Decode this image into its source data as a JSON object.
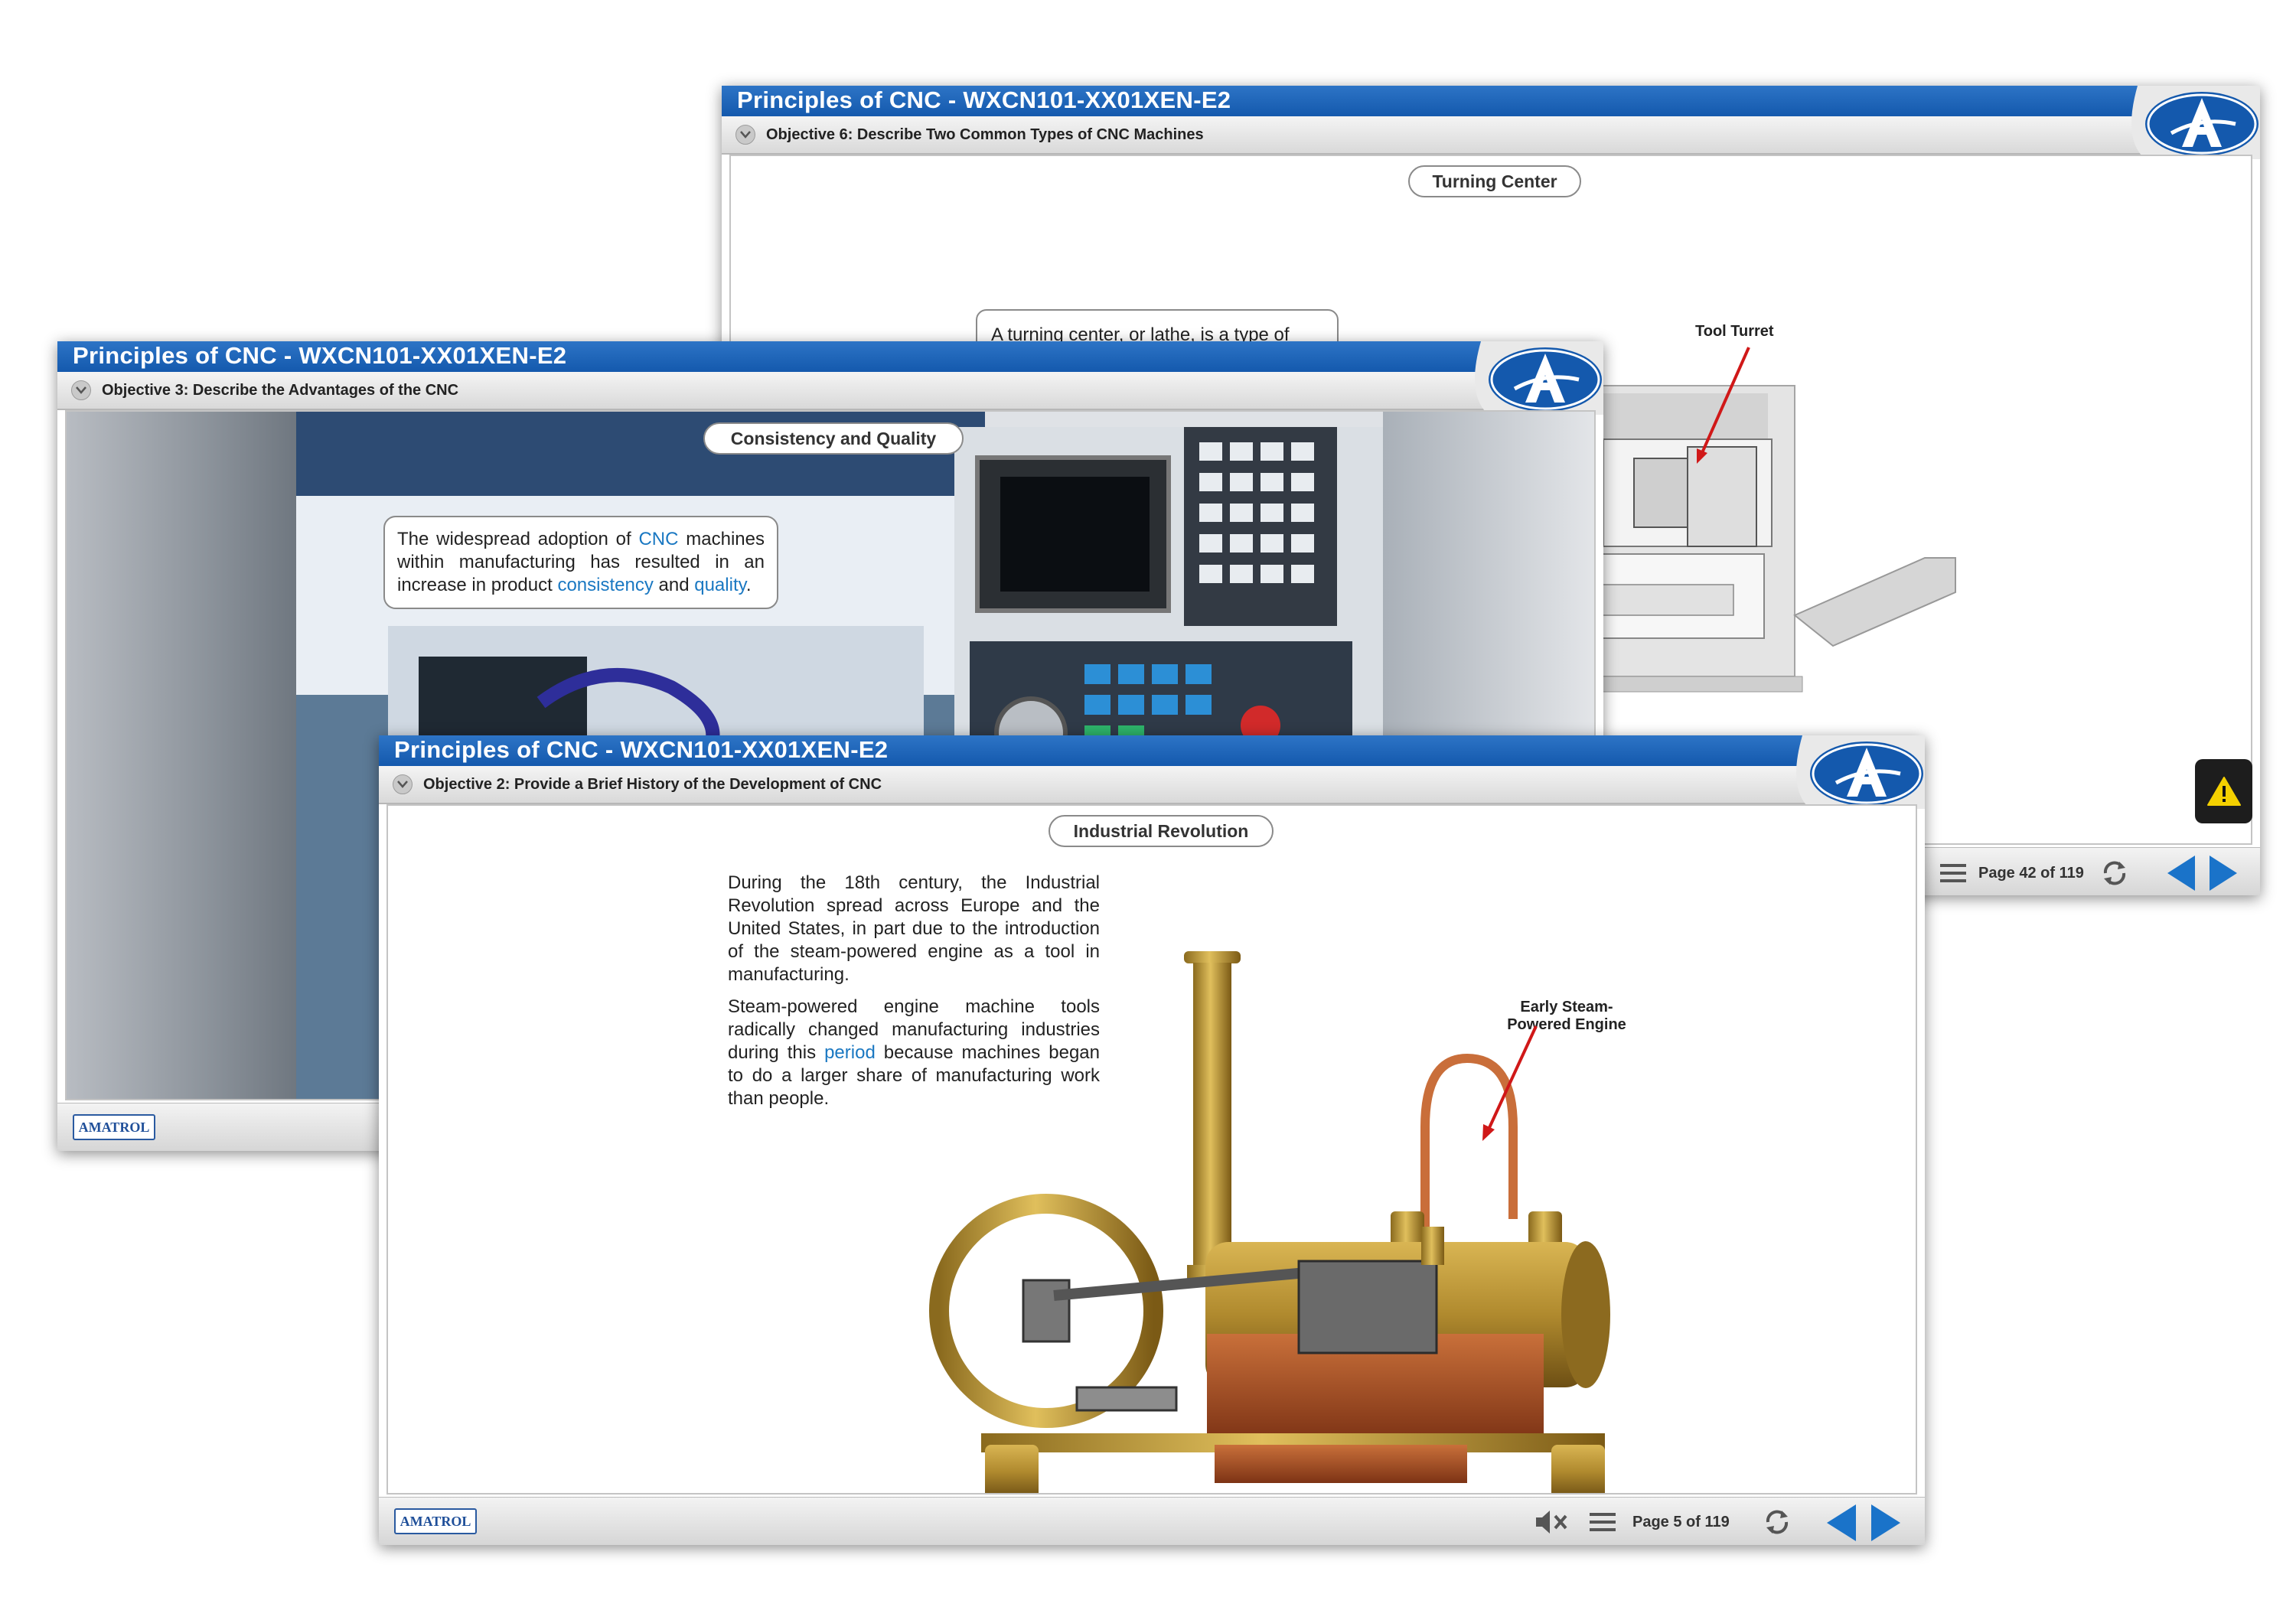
{
  "windows": {
    "back": {
      "title": "Principles of CNC - WXCN101-XX01XEN-E2",
      "objective": "Objective 6: Describe Two Common Types of CNC Machines",
      "section_pill": "Turning Center",
      "callout_text": "A turning center, or lathe, is a type of",
      "label_tool_turret": "Tool Turret",
      "page_indicator": "Page 42 of 119"
    },
    "middle": {
      "title": "Principles of CNC - WXCN101-XX01XEN-E2",
      "objective": "Objective 3: Describe the Advantages of the CNC",
      "section_pill": "Consistency and Quality",
      "callout": {
        "t1": "The widespread adoption of ",
        "h1": "CNC",
        "t2": " machines within manufacturing has resulted in an increase in product ",
        "h2": "consistency",
        "t3": " and ",
        "h3": "quality",
        "t4": "."
      },
      "logo": "AMATROL"
    },
    "front": {
      "title": "Principles of CNC - WXCN101-XX01XEN-E2",
      "objective": "Objective 2: Provide a Brief History of the Development of CNC",
      "section_pill": "Industrial Revolution",
      "paragraph1": "During the 18th century, the Industrial Revolution spread across Europe and the United States, in part due to the introduction of the steam-powered engine as a tool in manufacturing.",
      "paragraph2_a": "Steam-powered engine machine tools radically changed manufacturing industries during this ",
      "paragraph2_link": "period",
      "paragraph2_b": " because machines began to do a larger share of manufacturing work than people.",
      "label_engine_1": "Early Steam-",
      "label_engine_2": "Powered Engine",
      "page_indicator": "Page 5 of 119",
      "logo": "AMATROL"
    }
  },
  "icons": [
    "amatrol-a-logo-icon",
    "chevron-down-icon",
    "mute-icon",
    "menu-icon",
    "reload-icon",
    "prev-arrow-icon",
    "next-arrow-icon",
    "warning-icon"
  ],
  "colors": {
    "title_blue": "#1459ad",
    "link_blue": "#1a78c2",
    "nav_blue": "#1a73c9",
    "warning_yellow": "#f4d000",
    "arrow_red": "#d01818"
  }
}
